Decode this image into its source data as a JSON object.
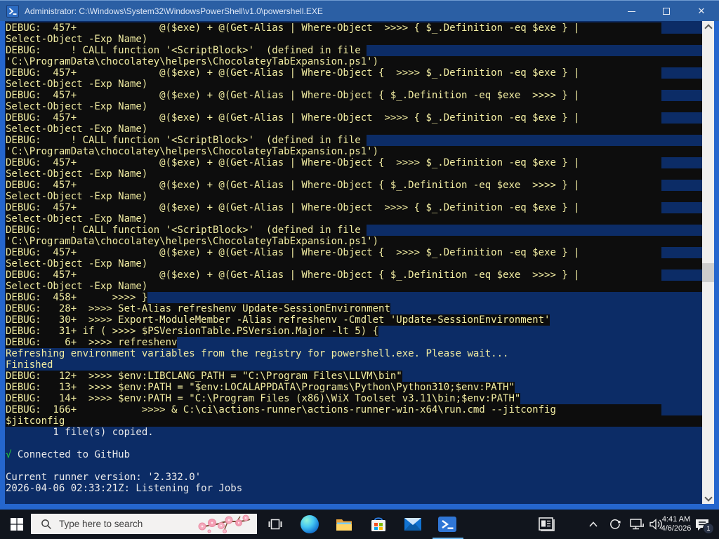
{
  "window": {
    "title": "Administrator: C:\\Windows\\System32\\WindowsPowerShell\\v1.0\\powershell.EXE",
    "controls": {
      "close_glyph": "✕"
    }
  },
  "console": {
    "colors": {
      "background": "#0c2c66",
      "debug_background": "#0d0d0d",
      "debug_yellow": "#f2eda2",
      "default_white": "#eaeaea",
      "success_green": "#21c93f",
      "scrollbar_track": "#f0efee"
    },
    "lines": [
      {
        "style": "debug-tail",
        "text": "DEBUG:  457+              @($exe) + @(Get-Alias | Where-Object  >>>> { $_.Definition -eq $exe } |"
      },
      {
        "style": "debug-fill",
        "text": "Select-Object -Exp Name)"
      },
      {
        "style": "debug",
        "text": "DEBUG:     ! CALL function '<ScriptBlock>'  (defined in file "
      },
      {
        "style": "debug-fill",
        "text": "'C:\\ProgramData\\chocolatey\\helpers\\ChocolateyTabExpansion.ps1')"
      },
      {
        "style": "debug-tail",
        "text": "DEBUG:  457+              @($exe) + @(Get-Alias | Where-Object {  >>>> $_.Definition -eq $exe } |"
      },
      {
        "style": "debug-fill",
        "text": "Select-Object -Exp Name)"
      },
      {
        "style": "debug-tail",
        "text": "DEBUG:  457+              @($exe) + @(Get-Alias | Where-Object { $_.Definition -eq $exe  >>>> } |"
      },
      {
        "style": "debug-fill",
        "text": "Select-Object -Exp Name)"
      },
      {
        "style": "debug-tail",
        "text": "DEBUG:  457+              @($exe) + @(Get-Alias | Where-Object  >>>> { $_.Definition -eq $exe } |"
      },
      {
        "style": "debug-fill",
        "text": "Select-Object -Exp Name)"
      },
      {
        "style": "debug",
        "text": "DEBUG:     ! CALL function '<ScriptBlock>'  (defined in file "
      },
      {
        "style": "debug-fill",
        "text": "'C:\\ProgramData\\chocolatey\\helpers\\ChocolateyTabExpansion.ps1')"
      },
      {
        "style": "debug-tail",
        "text": "DEBUG:  457+              @($exe) + @(Get-Alias | Where-Object {  >>>> $_.Definition -eq $exe } |"
      },
      {
        "style": "debug-fill",
        "text": "Select-Object -Exp Name)"
      },
      {
        "style": "debug-tail",
        "text": "DEBUG:  457+              @($exe) + @(Get-Alias | Where-Object { $_.Definition -eq $exe  >>>> } |"
      },
      {
        "style": "debug-fill",
        "text": "Select-Object -Exp Name)"
      },
      {
        "style": "debug-tail",
        "text": "DEBUG:  457+              @($exe) + @(Get-Alias | Where-Object  >>>> { $_.Definition -eq $exe } |"
      },
      {
        "style": "debug-fill",
        "text": "Select-Object -Exp Name)"
      },
      {
        "style": "debug",
        "text": "DEBUG:     ! CALL function '<ScriptBlock>'  (defined in file "
      },
      {
        "style": "debug-fill",
        "text": "'C:\\ProgramData\\chocolatey\\helpers\\ChocolateyTabExpansion.ps1')"
      },
      {
        "style": "debug-tail",
        "text": "DEBUG:  457+              @($exe) + @(Get-Alias | Where-Object {  >>>> $_.Definition -eq $exe } |"
      },
      {
        "style": "debug-fill",
        "text": "Select-Object -Exp Name)"
      },
      {
        "style": "debug-tail",
        "text": "DEBUG:  457+              @($exe) + @(Get-Alias | Where-Object { $_.Definition -eq $exe  >>>> } |"
      },
      {
        "style": "debug-fill",
        "text": "Select-Object -Exp Name)"
      },
      {
        "style": "debug",
        "text": "DEBUG:  458+      >>>> }"
      },
      {
        "style": "debug",
        "text": "DEBUG:   28+  >>>> Set-Alias refreshenv Update-SessionEnvironment"
      },
      {
        "style": "debug",
        "text": "DEBUG:   30+  >>>> Export-ModuleMember -Alias refreshenv -Cmdlet 'Update-SessionEnvironment'"
      },
      {
        "style": "debug",
        "text": "DEBUG:   31+ if ( >>>> $PSVersionTable.PSVersion.Major -lt 5) {"
      },
      {
        "style": "debug",
        "text": "DEBUG:    6+  >>>> refreshenv"
      },
      {
        "style": "yellow",
        "text": "Refreshing environment variables from the registry for powershell.exe. Please wait..."
      },
      {
        "style": "yellow",
        "text": "Finished"
      },
      {
        "style": "debug",
        "text": "DEBUG:   12+  >>>> $env:LIBCLANG_PATH = \"C:\\Program Files\\LLVM\\bin\""
      },
      {
        "style": "debug",
        "text": "DEBUG:   13+  >>>> $env:PATH = \"$env:LOCALAPPDATA\\Programs\\Python\\Python310;$env:PATH\""
      },
      {
        "style": "debug",
        "text": "DEBUG:   14+  >>>> $env:PATH = \"C:\\Program Files (x86)\\WiX Toolset v3.11\\bin;$env:PATH\""
      },
      {
        "style": "debug-tail",
        "text": "DEBUG:  166+           >>>> & C:\\ci\\actions-runner\\actions-runner-win-x64\\run.cmd --jitconfig "
      },
      {
        "style": "debug-fill",
        "text": "$jitconfig"
      },
      {
        "style": "white",
        "text": "        1 file(s) copied."
      },
      {
        "style": "blank",
        "text": ""
      },
      {
        "style": "check",
        "mark": "√",
        "text": " Connected to GitHub"
      },
      {
        "style": "blank",
        "text": ""
      },
      {
        "style": "white",
        "text": "Current runner version: '2.332.0'"
      },
      {
        "style": "white",
        "text": "2026-04-06 02:33:21Z: Listening for Jobs"
      }
    ]
  },
  "taskbar": {
    "search": {
      "placeholder": "Type here to search"
    },
    "clock": {
      "time": "4:41 AM",
      "date": "4/6/2026"
    },
    "notification_count": "1"
  }
}
